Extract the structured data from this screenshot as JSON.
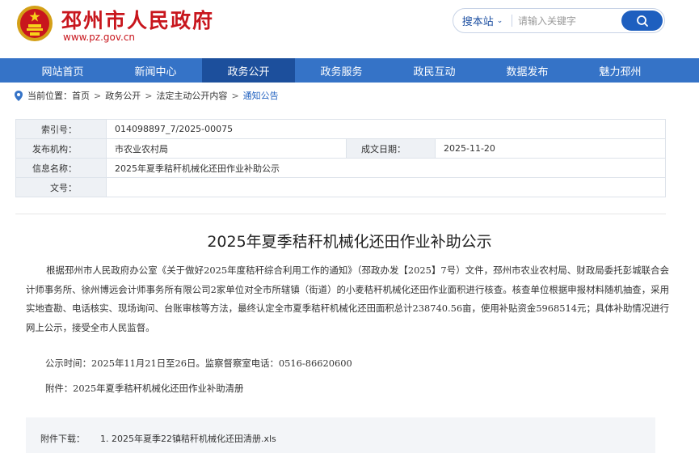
{
  "header": {
    "site_name": "邳州市人民政府",
    "site_domain": "www.pz.gov.cn",
    "search_scope": "搜本站",
    "search_placeholder": "请输入关键字"
  },
  "nav": {
    "items": [
      {
        "label": "网站首页"
      },
      {
        "label": "新闻中心"
      },
      {
        "label": "政务公开",
        "active": true
      },
      {
        "label": "政务服务"
      },
      {
        "label": "政民互动"
      },
      {
        "label": "数据发布"
      },
      {
        "label": "魅力邳州"
      }
    ]
  },
  "breadcrumb": {
    "prefix": "当前位置：",
    "items": [
      "首页",
      "政务公开",
      "法定主动公开内容",
      "通知公告"
    ],
    "separator": ">"
  },
  "info": {
    "index_label": "索引号：",
    "index_value": "014098897_7/2025-00075",
    "org_label": "发布机构：",
    "org_value": "市农业农村局",
    "date_label": "成文日期：",
    "date_value": "2025-11-20",
    "name_label": "信息名称：",
    "name_value": "2025年夏季秸秆机械化还田作业补助公示",
    "doc_label": "文号：",
    "doc_value": ""
  },
  "article": {
    "title": "2025年夏季秸秆机械化还田作业补助公示",
    "paragraph1": "根据邳州市人民政府办公室《关于做好2025年度秸秆综合利用工作的通知》（邳政办发【2025】7号）文件，邳州市农业农村局、财政局委托彭城联合会计师事务所、徐州博远会计师事务所有限公司2家单位对全市所辖镇（街道）的小麦秸秆机械化还田作业面积进行核查。核查单位根据申报材料随机抽查，采用实地查勘、电话核实、现场询问、台账审核等方法，最终认定全市夏季秸秆机械化还田面积总计238740.56亩，使用补贴资金5968514元；具体补助情况进行网上公示，接受全市人民监督。",
    "publicity": "公示时间：2025年11月21日至26日。监察督察室电话：0516-86620600",
    "attachment": "附件：2025年夏季秸秆机械化还田作业补助清册"
  },
  "download": {
    "label": "附件下载：",
    "file": "1. 2025年夏季22镇秸秆机械化还田清册.xls"
  },
  "colors": {
    "brand_red": "#c8161d",
    "nav_blue": "#3573c7",
    "nav_active": "#1c4f9c",
    "link_blue": "#1e5fbf"
  },
  "icons": {
    "emblem": "national-emblem-icon",
    "search": "search-icon",
    "location": "location-pin-icon",
    "chevron": "chevron-down-icon"
  }
}
